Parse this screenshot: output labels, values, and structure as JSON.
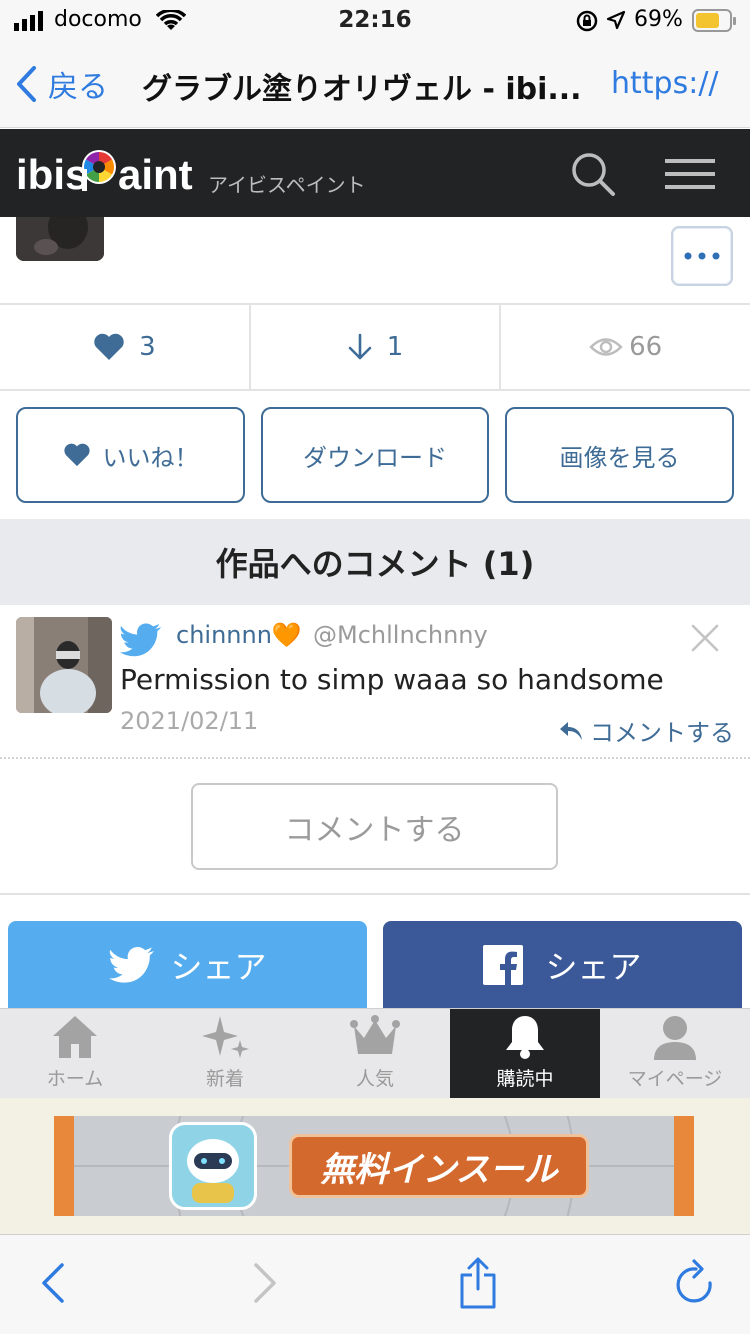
{
  "status": {
    "carrier": "docomo",
    "time": "22:16",
    "battery": "69%"
  },
  "nav": {
    "back_label": "戻る",
    "title": "グラブル塗りオリヴェル - ibi...",
    "url": "https://"
  },
  "header": {
    "logo_text": "ibisPaint",
    "logo_sub": "アイビスペイント"
  },
  "stats": {
    "likes": "3",
    "downloads": "1",
    "views": "66"
  },
  "actions": {
    "like": "いいね！",
    "download": "ダウンロード",
    "view_image": "画像を見る"
  },
  "comments": {
    "header": "作品へのコメント (1)",
    "items": [
      {
        "name": "chinnnn🧡",
        "handle": "@Mchllnchnny",
        "body": "Permission to simp waaa so handsome",
        "date": "2021/02/11",
        "reply": "コメントする"
      }
    ],
    "post_button": "コメントする"
  },
  "share": {
    "twitter": "シェア",
    "facebook": "シェア"
  },
  "tabs": [
    {
      "label": "ホーム",
      "icon": "home-icon"
    },
    {
      "label": "新着",
      "icon": "sparkle-icon"
    },
    {
      "label": "人気",
      "icon": "crown-icon"
    },
    {
      "label": "購読中",
      "icon": "bell-icon",
      "active": true
    },
    {
      "label": "マイページ",
      "icon": "person-icon"
    }
  ],
  "ad": {
    "label": "無料インスール"
  },
  "colors": {
    "accent": "#3f6c96",
    "link": "#2f7be0",
    "twitter": "#55acee",
    "facebook": "#3b5998",
    "header_bg": "#222324"
  }
}
